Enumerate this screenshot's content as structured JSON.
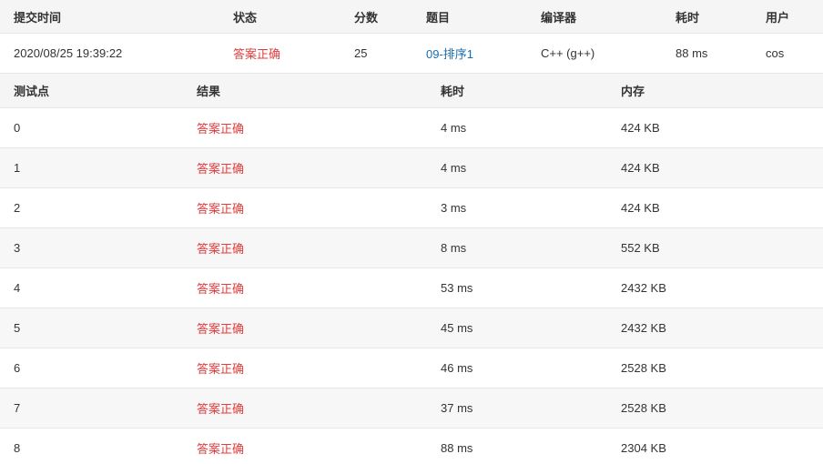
{
  "submission": {
    "headers": [
      "提交时间",
      "状态",
      "分数",
      "题目",
      "编译器",
      "耗时",
      "用户"
    ],
    "row": {
      "time": "2020/08/25 19:39:22",
      "status": "答案正确",
      "score": "25",
      "problem": "09-排序1",
      "compiler": "C++ (g++)",
      "elapsed": "88 ms",
      "user": "cos"
    }
  },
  "cases": {
    "headers": [
      "测试点",
      "结果",
      "耗时",
      "内存"
    ],
    "rows": [
      {
        "id": "0",
        "result": "答案正确",
        "time": "4 ms",
        "memory": "424 KB"
      },
      {
        "id": "1",
        "result": "答案正确",
        "time": "4 ms",
        "memory": "424 KB"
      },
      {
        "id": "2",
        "result": "答案正确",
        "time": "3 ms",
        "memory": "424 KB"
      },
      {
        "id": "3",
        "result": "答案正确",
        "time": "8 ms",
        "memory": "552 KB"
      },
      {
        "id": "4",
        "result": "答案正确",
        "time": "53 ms",
        "memory": "2432 KB"
      },
      {
        "id": "5",
        "result": "答案正确",
        "time": "45 ms",
        "memory": "2432 KB"
      },
      {
        "id": "6",
        "result": "答案正确",
        "time": "46 ms",
        "memory": "2528 KB"
      },
      {
        "id": "7",
        "result": "答案正确",
        "time": "37 ms",
        "memory": "2528 KB"
      },
      {
        "id": "8",
        "result": "答案正确",
        "time": "88 ms",
        "memory": "2304 KB"
      }
    ]
  },
  "colors": {
    "accepted": "#e03c3c",
    "link": "#1a6cb0",
    "header_bg": "#f5f5f5",
    "alt_row_bg": "#f7f7f7"
  }
}
